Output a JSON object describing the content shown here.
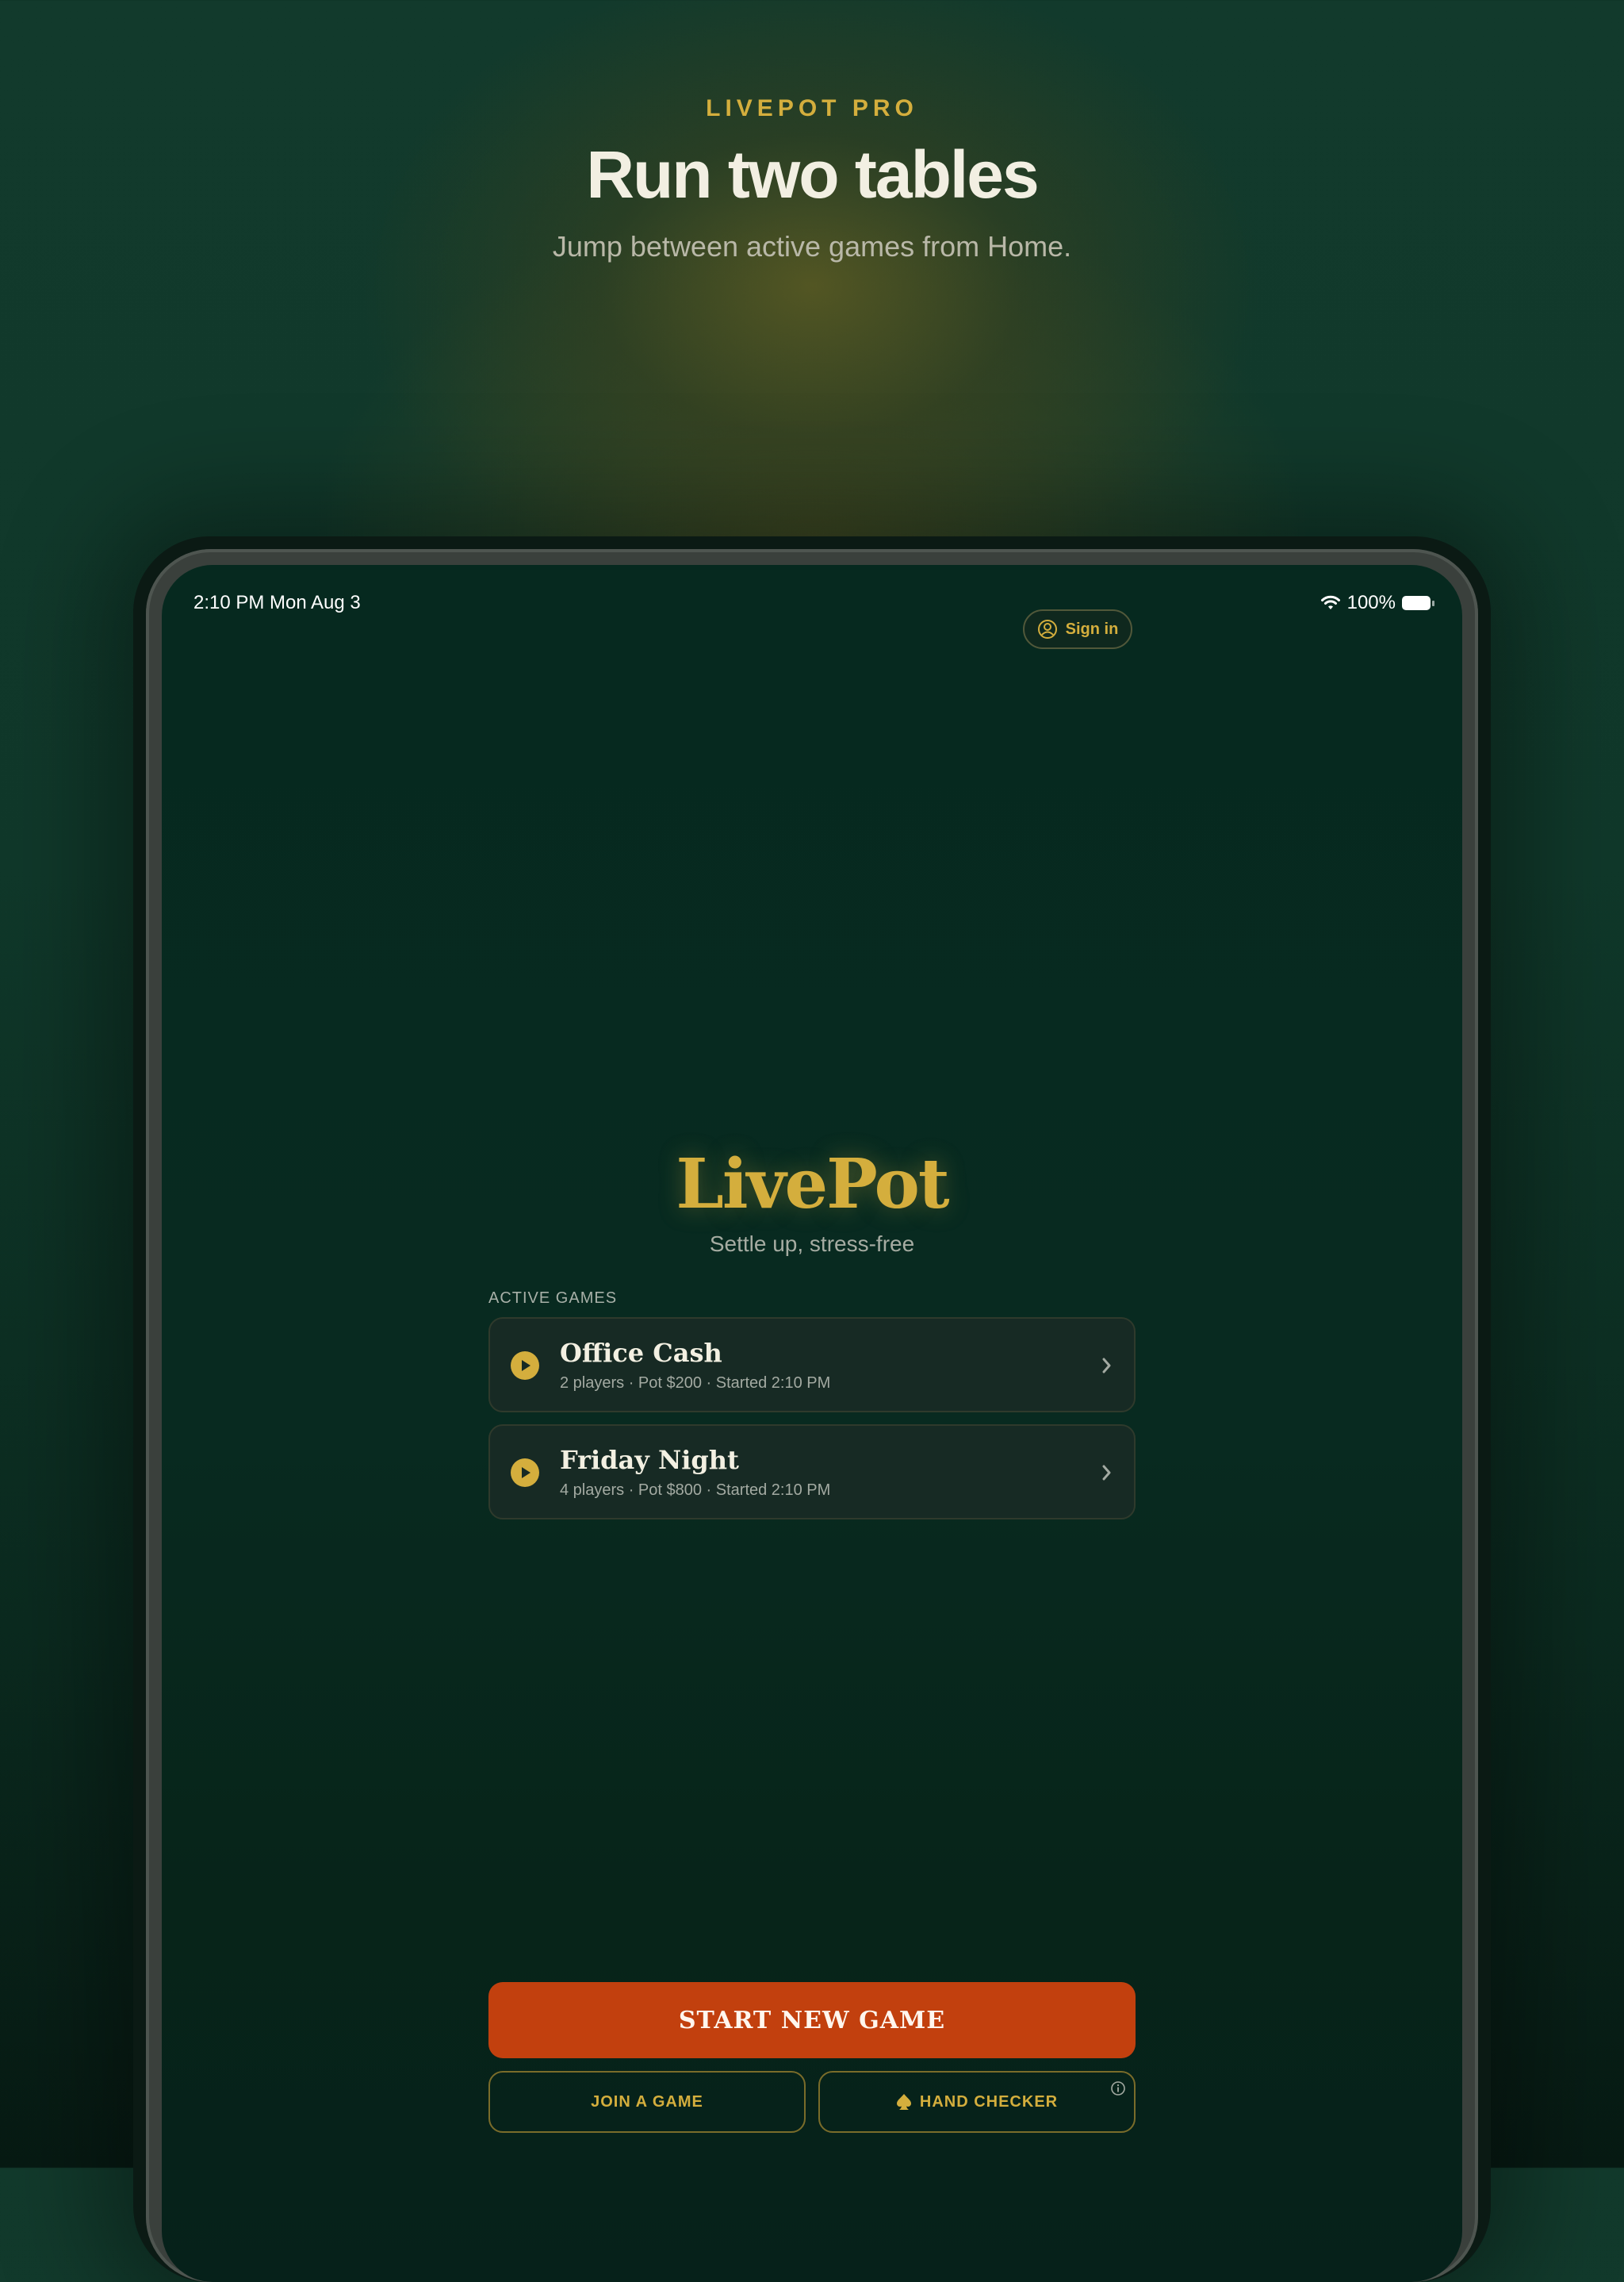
{
  "promo": {
    "eyebrow": "LIVEPOT PRO",
    "headline": "Run two tables",
    "subhead": "Jump between active games from Home."
  },
  "status_bar": {
    "time": "2:10 PM",
    "date": "Mon Aug 3",
    "battery": "100%",
    "wifi_icon": "wifi-icon",
    "battery_icon": "battery-icon"
  },
  "header": {
    "sign_in_label": "Sign in",
    "sign_in_icon": "user-circle-icon"
  },
  "home": {
    "brand": "LivePot",
    "tagline": "Settle up, stress-free",
    "active_games_label": "ACTIVE GAMES",
    "games": [
      {
        "name": "Office Cash",
        "meta": "2 players · Pot $200 · Started 2:10 PM"
      },
      {
        "name": "Friday Night",
        "meta": "4 players · Pot $800 · Started 2:10 PM"
      }
    ]
  },
  "actions": {
    "start_new_game": "START NEW GAME",
    "join_game": "JOIN A GAME",
    "hand_checker": "HAND CHECKER"
  },
  "colors": {
    "accent_gold": "#d4ae3d",
    "primary_button": "#c2400e",
    "background": "#082a20"
  }
}
